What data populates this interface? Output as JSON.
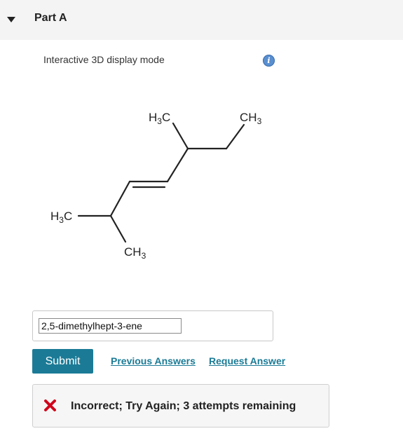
{
  "part": {
    "title": "Part A"
  },
  "display": {
    "mode_label": "Interactive 3D display mode"
  },
  "molecule": {
    "top_left_group": "H3C",
    "top_right_group": "CH3",
    "left_group": "H3C",
    "bottom_group": "CH3"
  },
  "answer": {
    "value": "2,5-dimethylhept-3-ene"
  },
  "actions": {
    "submit_label": "Submit",
    "previous_answers_label": "Previous Answers",
    "request_answer_label": "Request Answer"
  },
  "feedback": {
    "message": "Incorrect; Try Again; 3 attempts remaining",
    "status_color": "#d0021b"
  },
  "colors": {
    "accent": "#1b7b96",
    "info": "#5a8fd0"
  }
}
